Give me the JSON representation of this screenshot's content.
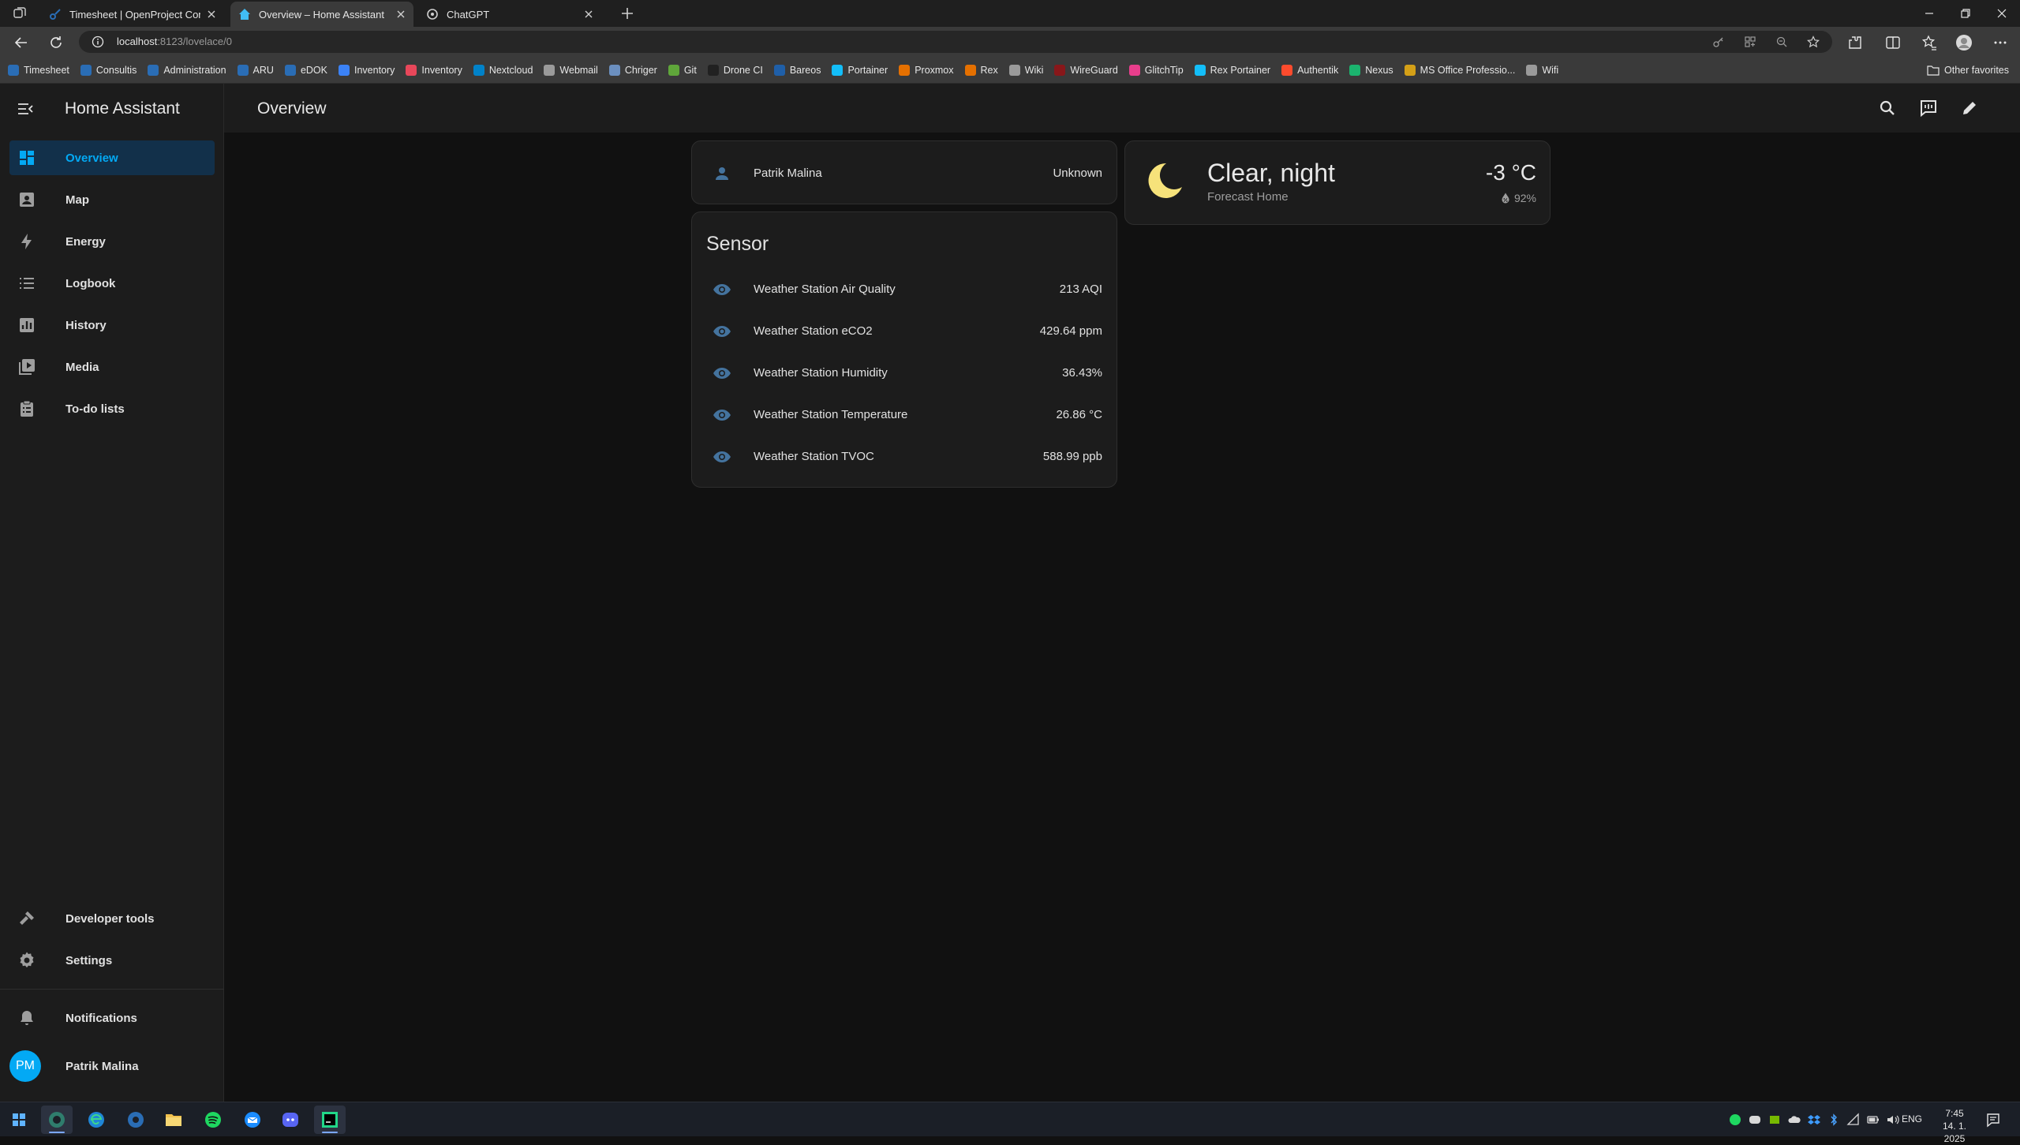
{
  "browser": {
    "tabs": [
      {
        "title": "Timesheet | OpenProject Consulti",
        "active": false
      },
      {
        "title": "Overview – Home Assistant",
        "active": true
      },
      {
        "title": "ChatGPT",
        "active": false
      }
    ],
    "url_host": "localhost",
    "url_path": ":8123/lovelace/0",
    "bookmarks": [
      {
        "label": "Timesheet",
        "color": "#2a6db5"
      },
      {
        "label": "Consultis",
        "color": "#2a6db5"
      },
      {
        "label": "Administration",
        "color": "#2a6db5"
      },
      {
        "label": "ARU",
        "color": "#2a6db5"
      },
      {
        "label": "eDOK",
        "color": "#2a6db5"
      },
      {
        "label": "Inventory",
        "color": "#3b82f6"
      },
      {
        "label": "Inventory",
        "color": "#e8475a"
      },
      {
        "label": "Nextcloud",
        "color": "#0082c9"
      },
      {
        "label": "Webmail",
        "color": "#9a9a9a"
      },
      {
        "label": "Chriger",
        "color": "#6b8fbf"
      },
      {
        "label": "Git",
        "color": "#5fa63a"
      },
      {
        "label": "Drone CI",
        "color": "#212121"
      },
      {
        "label": "Bareos",
        "color": "#1f5fa8"
      },
      {
        "label": "Portainer",
        "color": "#13bef9"
      },
      {
        "label": "Proxmox",
        "color": "#e57000"
      },
      {
        "label": "Rex",
        "color": "#e57000"
      },
      {
        "label": "Wiki",
        "color": "#9a9a9a"
      },
      {
        "label": "WireGuard",
        "color": "#88171a"
      },
      {
        "label": "GlitchTip",
        "color": "#e83e8c"
      },
      {
        "label": "Rex Portainer",
        "color": "#13bef9"
      },
      {
        "label": "Authentik",
        "color": "#fd4b2d"
      },
      {
        "label": "Nexus",
        "color": "#1bb36e"
      },
      {
        "label": "MS Office Professio...",
        "color": "#d4a017"
      },
      {
        "label": "Wifi",
        "color": "#9a9a9a"
      }
    ],
    "other_favorites": "Other favorites"
  },
  "ha": {
    "app_title": "Home Assistant",
    "page_title": "Overview",
    "accent_color": "#03a9f4",
    "nav": [
      {
        "label": "Overview",
        "icon": "view-dashboard-icon",
        "active": true
      },
      {
        "label": "Map",
        "icon": "map-icon",
        "active": false
      },
      {
        "label": "Energy",
        "icon": "lightning-bolt-icon",
        "active": false
      },
      {
        "label": "Logbook",
        "icon": "list-icon",
        "active": false
      },
      {
        "label": "History",
        "icon": "chart-box-icon",
        "active": false
      },
      {
        "label": "Media",
        "icon": "media-icon",
        "active": false
      },
      {
        "label": "To-do lists",
        "icon": "clipboard-list-icon",
        "active": false
      }
    ],
    "bottom": {
      "developer_tools": "Developer tools",
      "settings": "Settings",
      "notifications": "Notifications",
      "user_name": "Patrik Malina",
      "user_initials": "PM"
    },
    "person_card": {
      "name": "Patrik Malina",
      "state": "Unknown"
    },
    "sensor_card": {
      "title": "Sensor",
      "rows": [
        {
          "name": "Weather Station Air Quality",
          "value": "213 AQI"
        },
        {
          "name": "Weather Station eCO2",
          "value": "429.64 ppm"
        },
        {
          "name": "Weather Station Humidity",
          "value": "36.43%"
        },
        {
          "name": "Weather Station Temperature",
          "value": "26.86 °C"
        },
        {
          "name": "Weather Station TVOC",
          "value": "588.99 ppb"
        }
      ]
    },
    "weather_card": {
      "condition": "Clear, night",
      "name": "Forecast Home",
      "temperature": "-3 °C",
      "humidity": "92%",
      "icon": "moon-icon"
    }
  },
  "taskbar": {
    "language": "ENG",
    "time": "7:45",
    "date": "14. 1. 2025"
  }
}
